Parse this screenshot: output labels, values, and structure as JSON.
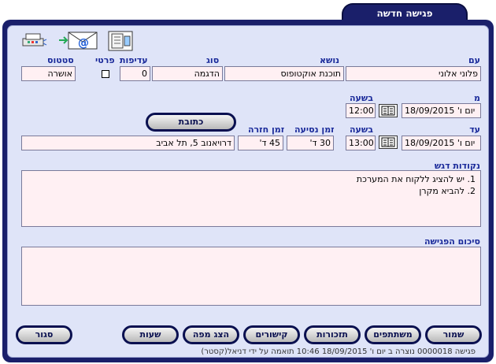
{
  "window": {
    "tab_title": "פגישה חדשה"
  },
  "toolbar": {
    "icons": [
      "fax-icon",
      "email-icon",
      "printer-icon"
    ]
  },
  "labels": {
    "with": "עם",
    "subject": "נושא",
    "type": "סוג",
    "priority": "עדיפות",
    "private": "פרטי",
    "status": "סטטוס",
    "from": "מ",
    "at_time_1": "בשעה",
    "to": "עד",
    "at_time_2": "בשעה",
    "travel_time": "זמן נסיעה",
    "return_time": "זמן חזרה",
    "key_points": "נקודות דגש",
    "summary": "סיכום הפגישה"
  },
  "fields": {
    "with": "פלוני אלוני",
    "subject": "תוכנת אוקטופוס",
    "type": "הדגמה",
    "priority": "0",
    "status": "אושרה",
    "from_date": "יום ו' 18/09/2015",
    "from_time": "12:00",
    "to_date": "יום ו' 18/09/2015",
    "to_time": "13:00",
    "travel_time": "30 ד'",
    "return_time": "45 ד'",
    "address": "דרויאנוב 5, תל אביב"
  },
  "key_points": [
    "1. יש להציג ללקוח את המערכת",
    "2. להביא מקרן"
  ],
  "summary": "",
  "buttons": {
    "address": "כתובת",
    "save": "שמור",
    "participants": "משתתפים",
    "reminders": "תזכורות",
    "links": "קישורים",
    "show_map": "הצג מפה",
    "hours": "שעות",
    "close": "סגור"
  },
  "status_bar": "פגישה 0000018 נוצרה ב יום ו' 18/09/2015 10:46 תואמה על ידי דניאל(קסטר)",
  "colors": {
    "frame": "#1a1f6a",
    "panel": "#dfe4f8",
    "label": "#1a2a9a",
    "field": "#fff0f3"
  }
}
